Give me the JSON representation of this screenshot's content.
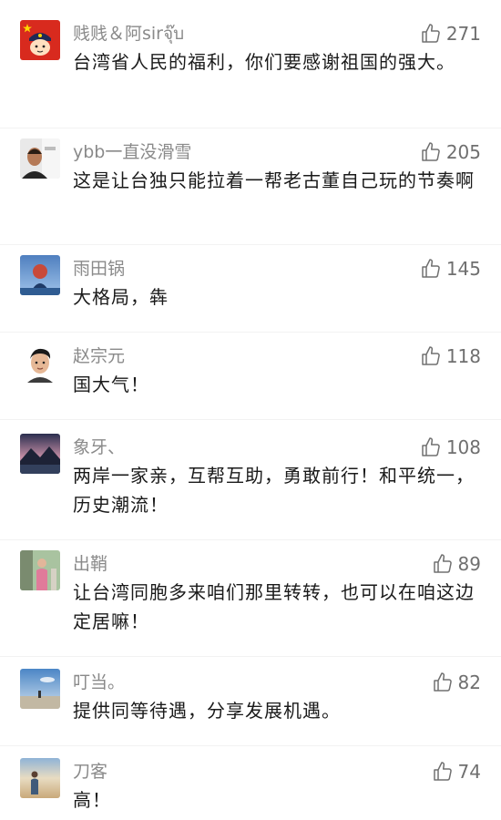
{
  "comments": [
    {
      "name": "贱贱＆阿sirจุ๊บ",
      "likes": "271",
      "text": "台湾省人民的福利，你们要感谢祖国的强大。",
      "avatar": "police-cartoon-avatar"
    },
    {
      "name": "ybb一直没滑雪",
      "likes": "205",
      "text": "这是让台独只能拉着一帮老古董自己玩的节奏啊",
      "avatar": "man-photo-avatar"
    },
    {
      "name": "雨田锅",
      "likes": "145",
      "text": "大格局，犇",
      "avatar": "astronaut-photo-avatar"
    },
    {
      "name": "赵宗元",
      "likes": "118",
      "text": "国大气！",
      "avatar": "cartoon-boy-avatar"
    },
    {
      "name": "象牙、",
      "likes": "108",
      "text": "两岸一家亲，互帮互助，勇敢前行！和平统一，历史潮流！",
      "avatar": "mountain-landscape-avatar"
    },
    {
      "name": "出鞘",
      "likes": "89",
      "text": "让台湾同胞多来咱们那里转转，也可以在咱这边定居嘛！",
      "avatar": "person-outdoor-avatar"
    },
    {
      "name": "叮当。",
      "likes": "82",
      "text": "提供同等待遇，分享发展机遇。",
      "avatar": "sky-landscape-avatar"
    },
    {
      "name": "刀客",
      "likes": "74",
      "text": "高！",
      "avatar": "desert-person-avatar"
    }
  ]
}
